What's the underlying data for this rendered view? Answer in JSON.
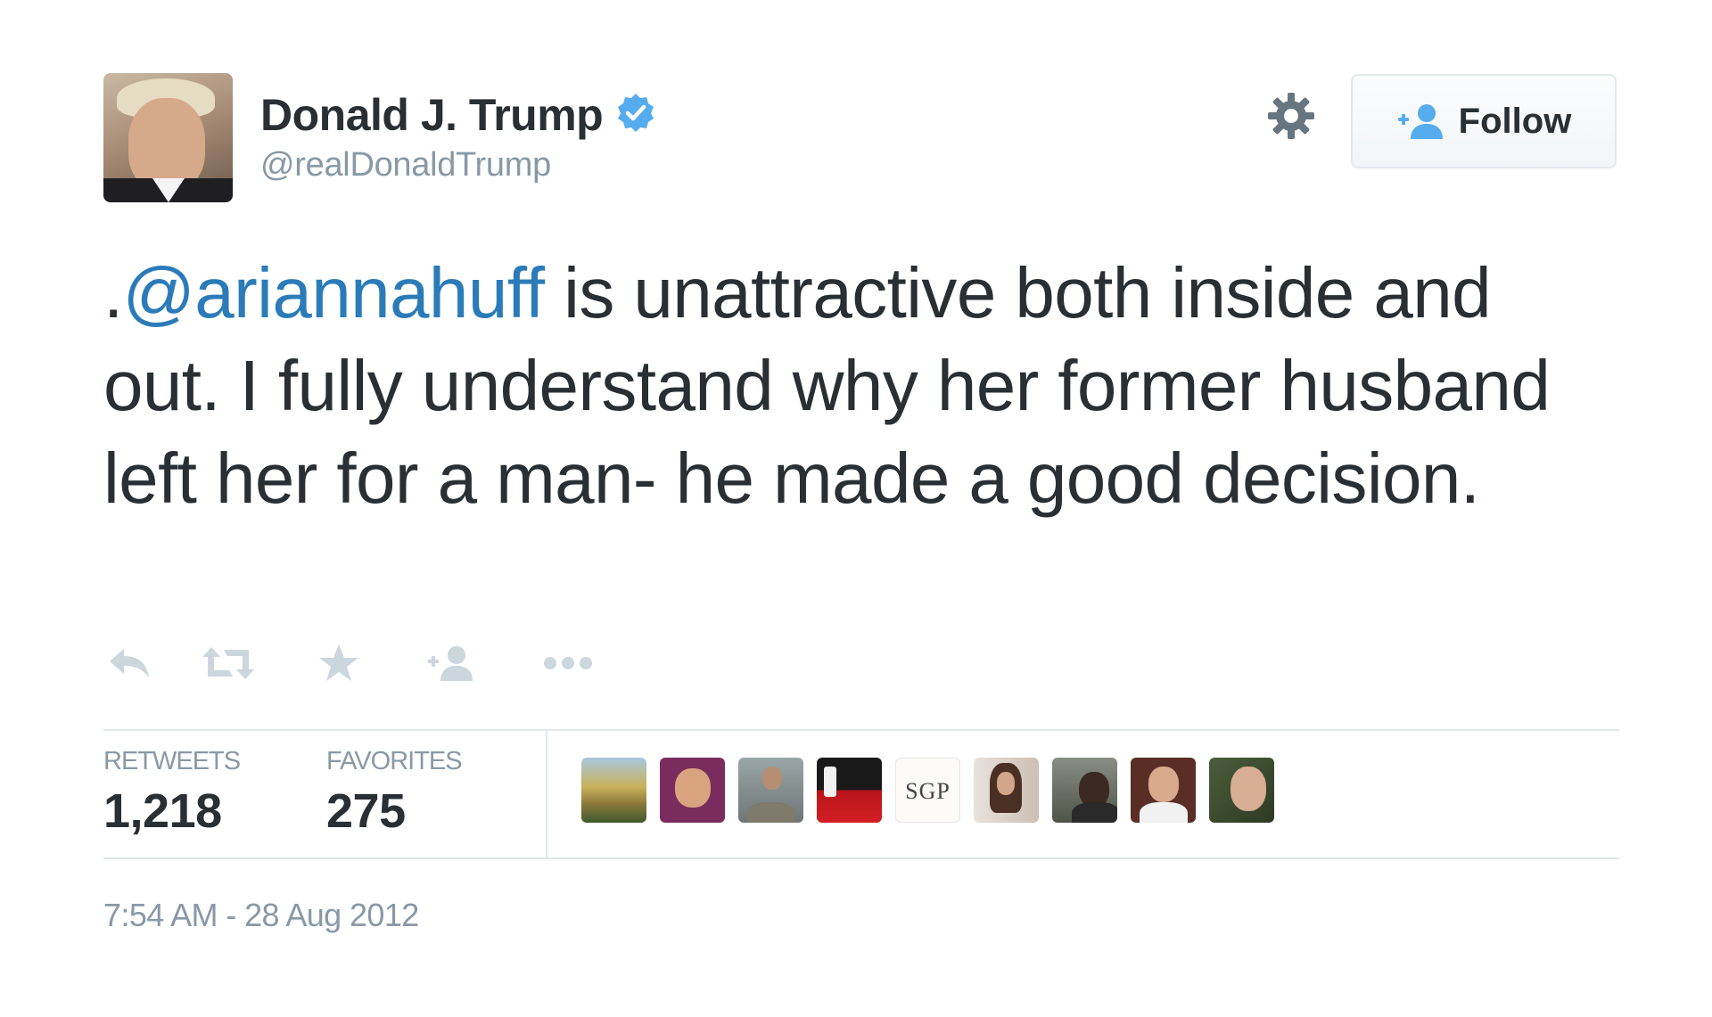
{
  "user": {
    "display_name": "Donald J. Trump",
    "handle": "@realDonaldTrump",
    "verified": true
  },
  "header": {
    "follow_label": "Follow",
    "settings_icon": "gear-icon",
    "follow_icon": "add-person-icon"
  },
  "tweet": {
    "prefix": ".",
    "mention": "@ariannahuff",
    "text": " is unattractive both inside and out. I fully understand why her former husband left her for a man- he made a good decision."
  },
  "actions": [
    "reply-icon",
    "retweet-icon",
    "favorite-icon",
    "follow-icon",
    "more-icon"
  ],
  "stats": {
    "retweets_label": "RETWEETS",
    "retweets_value": "1,218",
    "favorites_label": "FAVORITES",
    "favorites_value": "275"
  },
  "favorited_by": {
    "count_shown": 9,
    "badge_text": "SGP"
  },
  "timestamp": "7:54 AM - 28 Aug 2012",
  "colors": {
    "text": "#292f33",
    "muted": "#8899a6",
    "link": "#2b7bb9",
    "verified": "#55acee",
    "divider": "#e1e8ed",
    "icon_muted": "#ccd6dd"
  }
}
